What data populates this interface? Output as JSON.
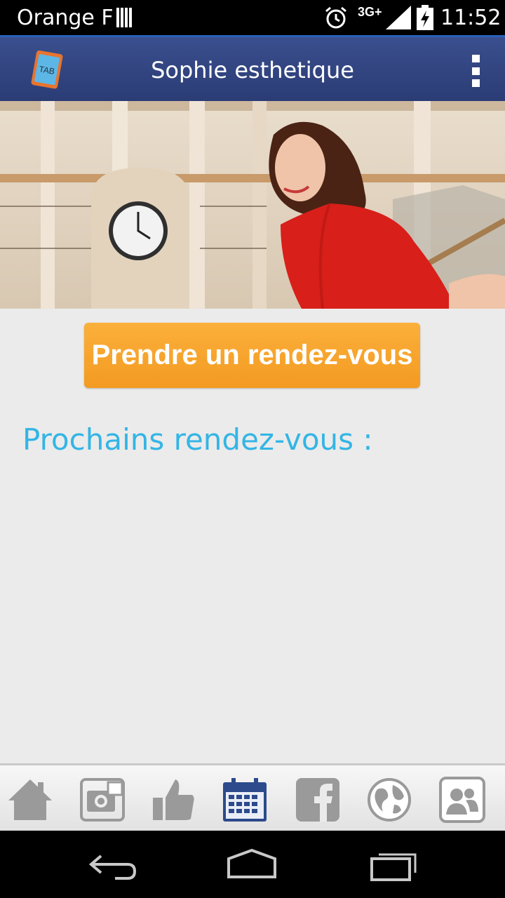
{
  "status_bar": {
    "carrier": "Orange F",
    "network": "3G+",
    "time": "11:52",
    "icons": [
      "sim-bars-icon",
      "alarm-icon",
      "signal-icon",
      "battery-charging-icon"
    ]
  },
  "action_bar": {
    "logo_text": "TAB",
    "title": "Sophie esthetique",
    "overflow_icon": "overflow-menu-icon"
  },
  "hero": {
    "icon": "hero-photo"
  },
  "main": {
    "cta_label": "Prendre un rendez-vous",
    "section_title": "Prochains rendez-vous :"
  },
  "tab_bar": {
    "active_index": 3,
    "active_color": "#2c4a8c",
    "inactive_color": "#9a9a9a",
    "tabs": [
      {
        "icon": "home-icon"
      },
      {
        "icon": "photo-gallery-icon"
      },
      {
        "icon": "thumbs-up-icon"
      },
      {
        "icon": "calendar-icon"
      },
      {
        "icon": "facebook-icon"
      },
      {
        "icon": "globe-icon"
      },
      {
        "icon": "contacts-icon"
      }
    ]
  },
  "nav_bar": {
    "icons": [
      "back-icon",
      "home-nav-icon",
      "recent-apps-icon"
    ]
  },
  "colors": {
    "accent": "#33b5e5",
    "cta": "#f7a530",
    "action_bar": "#34477f"
  }
}
